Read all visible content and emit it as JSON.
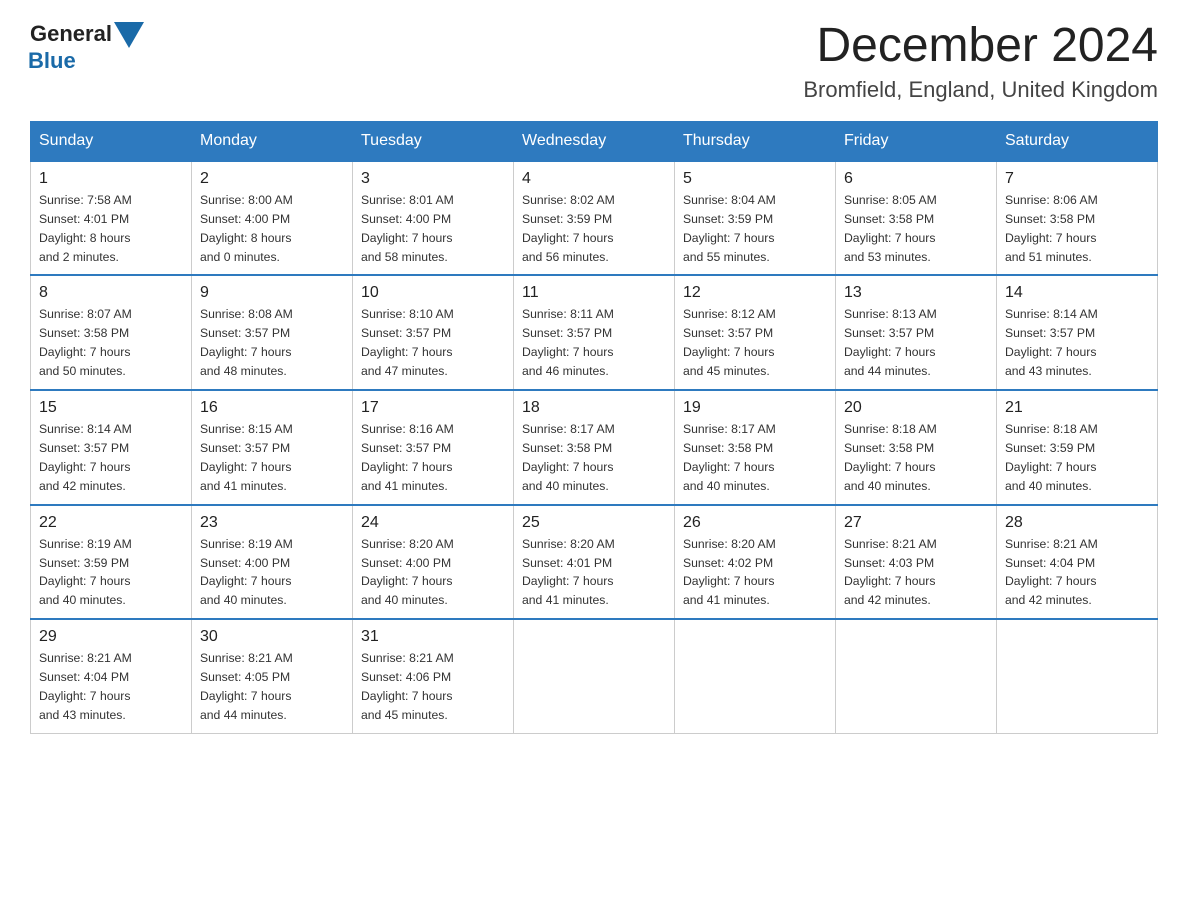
{
  "header": {
    "logo_general": "General",
    "logo_blue": "Blue",
    "month_title": "December 2024",
    "location": "Bromfield, England, United Kingdom"
  },
  "days_of_week": [
    "Sunday",
    "Monday",
    "Tuesday",
    "Wednesday",
    "Thursday",
    "Friday",
    "Saturday"
  ],
  "weeks": [
    [
      {
        "day": "1",
        "sunrise": "7:58 AM",
        "sunset": "4:01 PM",
        "daylight": "8 hours and 2 minutes."
      },
      {
        "day": "2",
        "sunrise": "8:00 AM",
        "sunset": "4:00 PM",
        "daylight": "8 hours and 0 minutes."
      },
      {
        "day": "3",
        "sunrise": "8:01 AM",
        "sunset": "4:00 PM",
        "daylight": "7 hours and 58 minutes."
      },
      {
        "day": "4",
        "sunrise": "8:02 AM",
        "sunset": "3:59 PM",
        "daylight": "7 hours and 56 minutes."
      },
      {
        "day": "5",
        "sunrise": "8:04 AM",
        "sunset": "3:59 PM",
        "daylight": "7 hours and 55 minutes."
      },
      {
        "day": "6",
        "sunrise": "8:05 AM",
        "sunset": "3:58 PM",
        "daylight": "7 hours and 53 minutes."
      },
      {
        "day": "7",
        "sunrise": "8:06 AM",
        "sunset": "3:58 PM",
        "daylight": "7 hours and 51 minutes."
      }
    ],
    [
      {
        "day": "8",
        "sunrise": "8:07 AM",
        "sunset": "3:58 PM",
        "daylight": "7 hours and 50 minutes."
      },
      {
        "day": "9",
        "sunrise": "8:08 AM",
        "sunset": "3:57 PM",
        "daylight": "7 hours and 48 minutes."
      },
      {
        "day": "10",
        "sunrise": "8:10 AM",
        "sunset": "3:57 PM",
        "daylight": "7 hours and 47 minutes."
      },
      {
        "day": "11",
        "sunrise": "8:11 AM",
        "sunset": "3:57 PM",
        "daylight": "7 hours and 46 minutes."
      },
      {
        "day": "12",
        "sunrise": "8:12 AM",
        "sunset": "3:57 PM",
        "daylight": "7 hours and 45 minutes."
      },
      {
        "day": "13",
        "sunrise": "8:13 AM",
        "sunset": "3:57 PM",
        "daylight": "7 hours and 44 minutes."
      },
      {
        "day": "14",
        "sunrise": "8:14 AM",
        "sunset": "3:57 PM",
        "daylight": "7 hours and 43 minutes."
      }
    ],
    [
      {
        "day": "15",
        "sunrise": "8:14 AM",
        "sunset": "3:57 PM",
        "daylight": "7 hours and 42 minutes."
      },
      {
        "day": "16",
        "sunrise": "8:15 AM",
        "sunset": "3:57 PM",
        "daylight": "7 hours and 41 minutes."
      },
      {
        "day": "17",
        "sunrise": "8:16 AM",
        "sunset": "3:57 PM",
        "daylight": "7 hours and 41 minutes."
      },
      {
        "day": "18",
        "sunrise": "8:17 AM",
        "sunset": "3:58 PM",
        "daylight": "7 hours and 40 minutes."
      },
      {
        "day": "19",
        "sunrise": "8:17 AM",
        "sunset": "3:58 PM",
        "daylight": "7 hours and 40 minutes."
      },
      {
        "day": "20",
        "sunrise": "8:18 AM",
        "sunset": "3:58 PM",
        "daylight": "7 hours and 40 minutes."
      },
      {
        "day": "21",
        "sunrise": "8:18 AM",
        "sunset": "3:59 PM",
        "daylight": "7 hours and 40 minutes."
      }
    ],
    [
      {
        "day": "22",
        "sunrise": "8:19 AM",
        "sunset": "3:59 PM",
        "daylight": "7 hours and 40 minutes."
      },
      {
        "day": "23",
        "sunrise": "8:19 AM",
        "sunset": "4:00 PM",
        "daylight": "7 hours and 40 minutes."
      },
      {
        "day": "24",
        "sunrise": "8:20 AM",
        "sunset": "4:00 PM",
        "daylight": "7 hours and 40 minutes."
      },
      {
        "day": "25",
        "sunrise": "8:20 AM",
        "sunset": "4:01 PM",
        "daylight": "7 hours and 41 minutes."
      },
      {
        "day": "26",
        "sunrise": "8:20 AM",
        "sunset": "4:02 PM",
        "daylight": "7 hours and 41 minutes."
      },
      {
        "day": "27",
        "sunrise": "8:21 AM",
        "sunset": "4:03 PM",
        "daylight": "7 hours and 42 minutes."
      },
      {
        "day": "28",
        "sunrise": "8:21 AM",
        "sunset": "4:04 PM",
        "daylight": "7 hours and 42 minutes."
      }
    ],
    [
      {
        "day": "29",
        "sunrise": "8:21 AM",
        "sunset": "4:04 PM",
        "daylight": "7 hours and 43 minutes."
      },
      {
        "day": "30",
        "sunrise": "8:21 AM",
        "sunset": "4:05 PM",
        "daylight": "7 hours and 44 minutes."
      },
      {
        "day": "31",
        "sunrise": "8:21 AM",
        "sunset": "4:06 PM",
        "daylight": "7 hours and 45 minutes."
      },
      null,
      null,
      null,
      null
    ]
  ],
  "labels": {
    "sunrise_prefix": "Sunrise: ",
    "sunset_prefix": "Sunset: ",
    "daylight_prefix": "Daylight: "
  }
}
